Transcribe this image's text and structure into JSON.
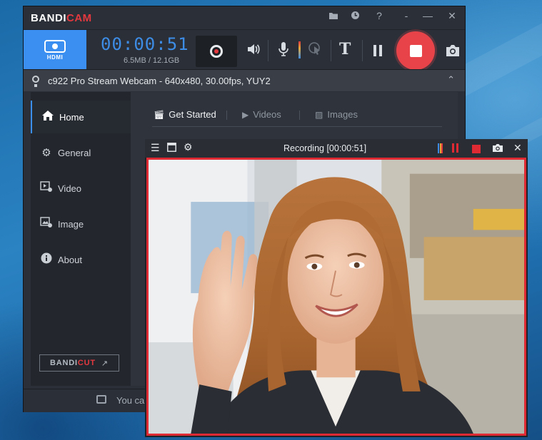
{
  "app": {
    "logo_main": "BANDI",
    "logo_accent": "CAM",
    "titlebar_icons": [
      "folder-icon",
      "clock-icon",
      "help-icon",
      "minimize-icon",
      "maximize-icon",
      "close-icon"
    ]
  },
  "toolbar": {
    "hdmi_label": "HDMI",
    "timer": "00:00:51",
    "size": "6.5MB / 12.1GB"
  },
  "device": {
    "label": "c922 Pro Stream Webcam - 640x480, 30.00fps, YUY2"
  },
  "sidebar": {
    "items": [
      {
        "label": "Home",
        "icon": "home-icon"
      },
      {
        "label": "General",
        "icon": "gear-icon"
      },
      {
        "label": "Video",
        "icon": "video-settings-icon"
      },
      {
        "label": "Image",
        "icon": "image-settings-icon"
      },
      {
        "label": "About",
        "icon": "info-icon"
      }
    ],
    "bandicut_main": "BANDI",
    "bandicut_accent": "CUT",
    "bandicut_arrow": "↗"
  },
  "tabs": [
    {
      "label": "Get Started",
      "icon": "clapper-icon"
    },
    {
      "label": "Videos",
      "icon": "film-icon"
    },
    {
      "label": "Images",
      "icon": "picture-icon"
    }
  ],
  "status": {
    "text": "You can"
  },
  "recording_window": {
    "title": "Recording [00:00:51]"
  },
  "colors": {
    "accent_blue": "#3a8ff0",
    "record_red": "#e9434a",
    "frame_red": "#e02a33",
    "timer_blue": "#3d8ce6"
  }
}
